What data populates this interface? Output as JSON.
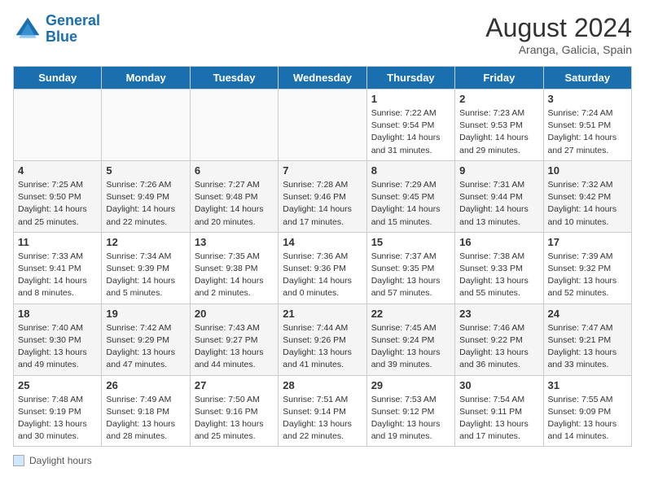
{
  "header": {
    "logo_general": "General",
    "logo_blue": "Blue",
    "month_year": "August 2024",
    "location": "Aranga, Galicia, Spain"
  },
  "legend": {
    "label": "Daylight hours"
  },
  "days_of_week": [
    "Sunday",
    "Monday",
    "Tuesday",
    "Wednesday",
    "Thursday",
    "Friday",
    "Saturday"
  ],
  "weeks": [
    [
      {
        "day": "",
        "info": ""
      },
      {
        "day": "",
        "info": ""
      },
      {
        "day": "",
        "info": ""
      },
      {
        "day": "",
        "info": ""
      },
      {
        "day": "1",
        "info": "Sunrise: 7:22 AM\nSunset: 9:54 PM\nDaylight: 14 hours and 31 minutes."
      },
      {
        "day": "2",
        "info": "Sunrise: 7:23 AM\nSunset: 9:53 PM\nDaylight: 14 hours and 29 minutes."
      },
      {
        "day": "3",
        "info": "Sunrise: 7:24 AM\nSunset: 9:51 PM\nDaylight: 14 hours and 27 minutes."
      }
    ],
    [
      {
        "day": "4",
        "info": "Sunrise: 7:25 AM\nSunset: 9:50 PM\nDaylight: 14 hours and 25 minutes."
      },
      {
        "day": "5",
        "info": "Sunrise: 7:26 AM\nSunset: 9:49 PM\nDaylight: 14 hours and 22 minutes."
      },
      {
        "day": "6",
        "info": "Sunrise: 7:27 AM\nSunset: 9:48 PM\nDaylight: 14 hours and 20 minutes."
      },
      {
        "day": "7",
        "info": "Sunrise: 7:28 AM\nSunset: 9:46 PM\nDaylight: 14 hours and 17 minutes."
      },
      {
        "day": "8",
        "info": "Sunrise: 7:29 AM\nSunset: 9:45 PM\nDaylight: 14 hours and 15 minutes."
      },
      {
        "day": "9",
        "info": "Sunrise: 7:31 AM\nSunset: 9:44 PM\nDaylight: 14 hours and 13 minutes."
      },
      {
        "day": "10",
        "info": "Sunrise: 7:32 AM\nSunset: 9:42 PM\nDaylight: 14 hours and 10 minutes."
      }
    ],
    [
      {
        "day": "11",
        "info": "Sunrise: 7:33 AM\nSunset: 9:41 PM\nDaylight: 14 hours and 8 minutes."
      },
      {
        "day": "12",
        "info": "Sunrise: 7:34 AM\nSunset: 9:39 PM\nDaylight: 14 hours and 5 minutes."
      },
      {
        "day": "13",
        "info": "Sunrise: 7:35 AM\nSunset: 9:38 PM\nDaylight: 14 hours and 2 minutes."
      },
      {
        "day": "14",
        "info": "Sunrise: 7:36 AM\nSunset: 9:36 PM\nDaylight: 14 hours and 0 minutes."
      },
      {
        "day": "15",
        "info": "Sunrise: 7:37 AM\nSunset: 9:35 PM\nDaylight: 13 hours and 57 minutes."
      },
      {
        "day": "16",
        "info": "Sunrise: 7:38 AM\nSunset: 9:33 PM\nDaylight: 13 hours and 55 minutes."
      },
      {
        "day": "17",
        "info": "Sunrise: 7:39 AM\nSunset: 9:32 PM\nDaylight: 13 hours and 52 minutes."
      }
    ],
    [
      {
        "day": "18",
        "info": "Sunrise: 7:40 AM\nSunset: 9:30 PM\nDaylight: 13 hours and 49 minutes."
      },
      {
        "day": "19",
        "info": "Sunrise: 7:42 AM\nSunset: 9:29 PM\nDaylight: 13 hours and 47 minutes."
      },
      {
        "day": "20",
        "info": "Sunrise: 7:43 AM\nSunset: 9:27 PM\nDaylight: 13 hours and 44 minutes."
      },
      {
        "day": "21",
        "info": "Sunrise: 7:44 AM\nSunset: 9:26 PM\nDaylight: 13 hours and 41 minutes."
      },
      {
        "day": "22",
        "info": "Sunrise: 7:45 AM\nSunset: 9:24 PM\nDaylight: 13 hours and 39 minutes."
      },
      {
        "day": "23",
        "info": "Sunrise: 7:46 AM\nSunset: 9:22 PM\nDaylight: 13 hours and 36 minutes."
      },
      {
        "day": "24",
        "info": "Sunrise: 7:47 AM\nSunset: 9:21 PM\nDaylight: 13 hours and 33 minutes."
      }
    ],
    [
      {
        "day": "25",
        "info": "Sunrise: 7:48 AM\nSunset: 9:19 PM\nDaylight: 13 hours and 30 minutes."
      },
      {
        "day": "26",
        "info": "Sunrise: 7:49 AM\nSunset: 9:18 PM\nDaylight: 13 hours and 28 minutes."
      },
      {
        "day": "27",
        "info": "Sunrise: 7:50 AM\nSunset: 9:16 PM\nDaylight: 13 hours and 25 minutes."
      },
      {
        "day": "28",
        "info": "Sunrise: 7:51 AM\nSunset: 9:14 PM\nDaylight: 13 hours and 22 minutes."
      },
      {
        "day": "29",
        "info": "Sunrise: 7:53 AM\nSunset: 9:12 PM\nDaylight: 13 hours and 19 minutes."
      },
      {
        "day": "30",
        "info": "Sunrise: 7:54 AM\nSunset: 9:11 PM\nDaylight: 13 hours and 17 minutes."
      },
      {
        "day": "31",
        "info": "Sunrise: 7:55 AM\nSunset: 9:09 PM\nDaylight: 13 hours and 14 minutes."
      }
    ]
  ]
}
